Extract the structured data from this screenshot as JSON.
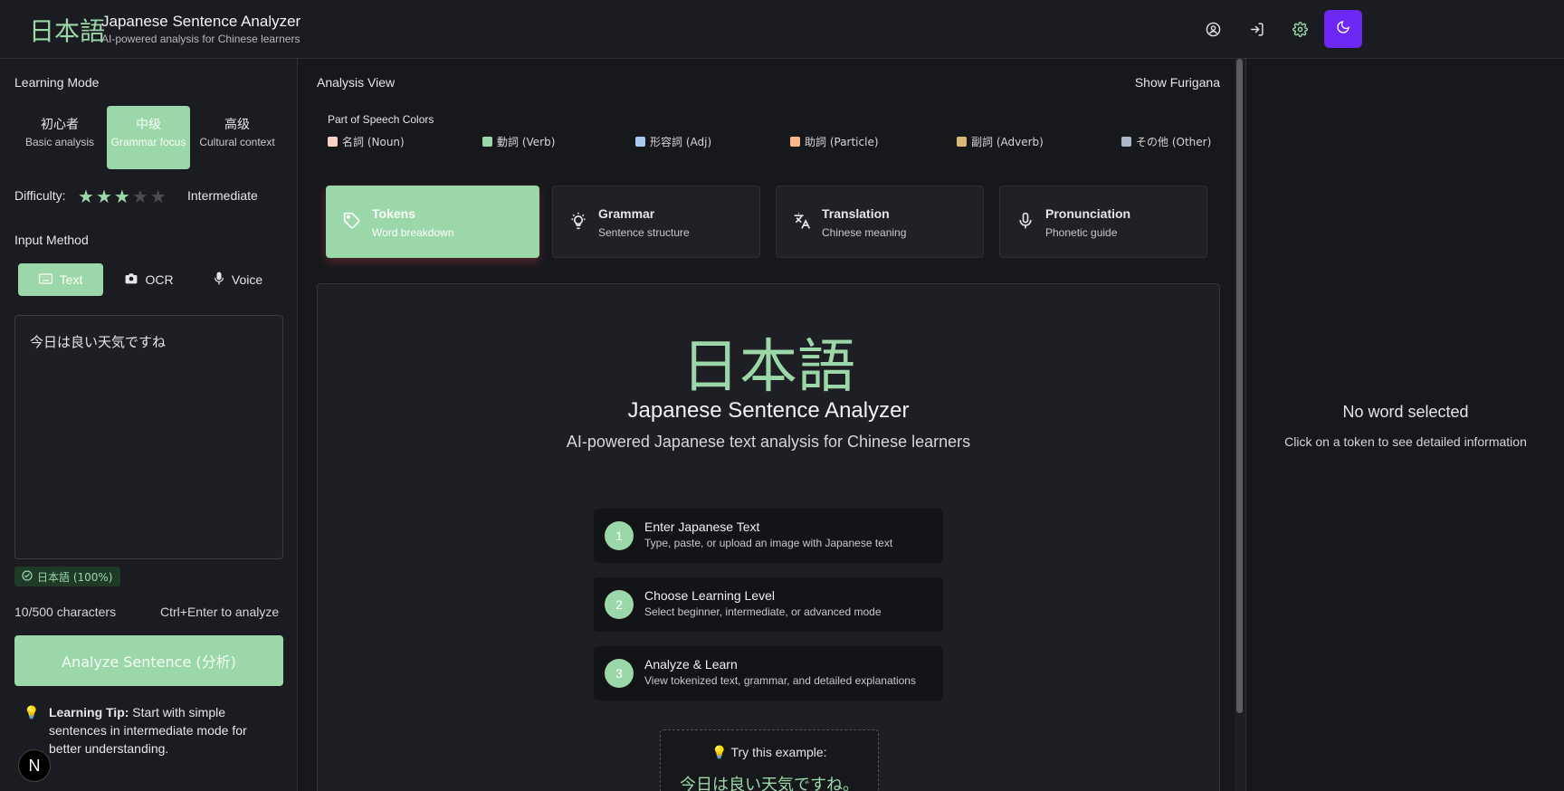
{
  "header": {
    "logo": "日本語",
    "title": "Japanese Sentence Analyzer",
    "subtitle": "AI-powered analysis for Chinese learners",
    "icons": [
      "user-icon",
      "login-icon",
      "gear-icon",
      "moon-icon"
    ],
    "accent_color": "#6d28f5"
  },
  "sidebar": {
    "learning_mode_title": "Learning Mode",
    "modes": [
      {
        "title": "初心者",
        "desc": "Basic analysis",
        "active": false
      },
      {
        "title": "中级",
        "desc": "Grammar focus",
        "active": true
      },
      {
        "title": "高级",
        "desc": "Cultural context",
        "active": false
      }
    ],
    "difficulty_label": "Difficulty:",
    "difficulty_stars": 3,
    "difficulty_max": 5,
    "difficulty_value": "Intermediate",
    "input_method_title": "Input Method",
    "input_methods": [
      {
        "label": "Text",
        "icon": "keyboard-icon",
        "active": true
      },
      {
        "label": "OCR",
        "icon": "camera-icon",
        "active": false
      },
      {
        "label": "Voice",
        "icon": "microphone-icon",
        "active": false
      }
    ],
    "input_value": "今日は良い天気ですね",
    "language_badge": "日本語 (100%)",
    "char_count": "10/500 characters",
    "shortcut_hint": "Ctrl+Enter to analyze",
    "analyze_button": "Analyze Sentence (分析)",
    "tip_label": "Learning Tip:",
    "tip_text": " Start with simple sentences in intermediate mode for better understanding.",
    "floating_badge": "N",
    "primary_color": "#9bd7a8"
  },
  "main": {
    "analysis_view_title": "Analysis View",
    "show_furigana": "Show Furigana",
    "pos_title": "Part of Speech Colors",
    "pos_items": [
      {
        "label": "名詞 (Noun)",
        "color": "#f6d3c4"
      },
      {
        "label": "動詞 (Verb)",
        "color": "#9bd7a8"
      },
      {
        "label": "形容詞 (Adj)",
        "color": "#a9c9ef"
      },
      {
        "label": "助詞 (Particle)",
        "color": "#f4b88a"
      },
      {
        "label": "副詞 (Adverb)",
        "color": "#d8b779"
      },
      {
        "label": "その他 (Other)",
        "color": "#a9b7c9"
      }
    ],
    "tabs": [
      {
        "label": "Tokens",
        "desc": "Word breakdown",
        "icon": "tag-icon",
        "active": true
      },
      {
        "label": "Grammar",
        "desc": "Sentence structure",
        "icon": "lightbulb-icon",
        "active": false
      },
      {
        "label": "Translation",
        "desc": "Chinese meaning",
        "icon": "translate-icon",
        "active": false
      },
      {
        "label": "Pronunciation",
        "desc": "Phonetic guide",
        "icon": "microphone-icon",
        "active": false
      }
    ],
    "welcome": {
      "logo": "日本語",
      "title": "Japanese Sentence Analyzer",
      "subtitle": "AI-powered Japanese text analysis for Chinese learners"
    },
    "steps": [
      {
        "num": "1",
        "title": "Enter Japanese Text",
        "desc": "Type, paste, or upload an image with Japanese text"
      },
      {
        "num": "2",
        "title": "Choose Learning Level",
        "desc": "Select beginner, intermediate, or advanced mode"
      },
      {
        "num": "3",
        "title": "Analyze & Learn",
        "desc": "View tokenized text, grammar, and detailed explanations"
      }
    ],
    "example_title": "💡 Try this example:",
    "example_sentence": "今日は良い天気ですね。"
  },
  "detail": {
    "empty_title": "No word selected",
    "empty_sub": "Click on a token to see detailed information"
  }
}
